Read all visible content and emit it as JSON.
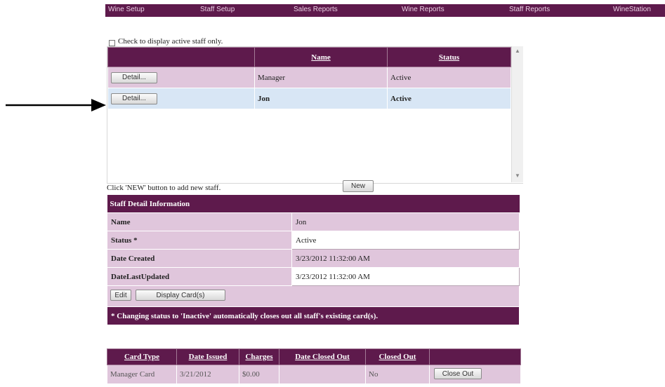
{
  "nav": {
    "items": [
      "Wine Setup",
      "Staff Setup",
      "Sales Reports",
      "Wine Reports",
      "Staff Reports",
      "WineStation"
    ]
  },
  "filter": {
    "active_only_label": "Check to display active staff only."
  },
  "staff_list": {
    "columns": [
      "",
      "Name",
      "Status"
    ],
    "rows": [
      {
        "button": "Detail...",
        "name": "Manager",
        "status": "Active",
        "selected": false
      },
      {
        "button": "Detail...",
        "name": "Jon",
        "status": "Active",
        "selected": true
      }
    ]
  },
  "add_staff": {
    "hint": "Click 'NEW' button to add new staff.",
    "new_button": "New"
  },
  "detail": {
    "title": "Staff Detail Information",
    "fields": [
      {
        "label": "Name",
        "value": "Jon"
      },
      {
        "label": "Status *",
        "value": "Active"
      },
      {
        "label": "Date Created",
        "value": "3/23/2012 11:32:00 AM"
      },
      {
        "label": "DateLastUpdated",
        "value": "3/23/2012 11:32:00 AM"
      }
    ],
    "edit_button": "Edit",
    "display_cards_button": "Display Card(s)",
    "note": "* Changing status to 'Inactive' automatically closes out all staff's existing card(s)."
  },
  "cards": {
    "columns": [
      "Card Type",
      "Date Issued",
      "Charges",
      "Date Closed Out",
      "Closed Out",
      ""
    ],
    "rows": [
      {
        "card_type": "Manager Card",
        "date_issued": "3/21/2012",
        "charges": "$0.00",
        "date_closed_out": "",
        "closed_out": "No",
        "button": "Close Out"
      }
    ]
  },
  "colors": {
    "header": "#5e1a4c",
    "row_shade": "#e0c6dc",
    "selected_row": "#d8e6f5"
  }
}
